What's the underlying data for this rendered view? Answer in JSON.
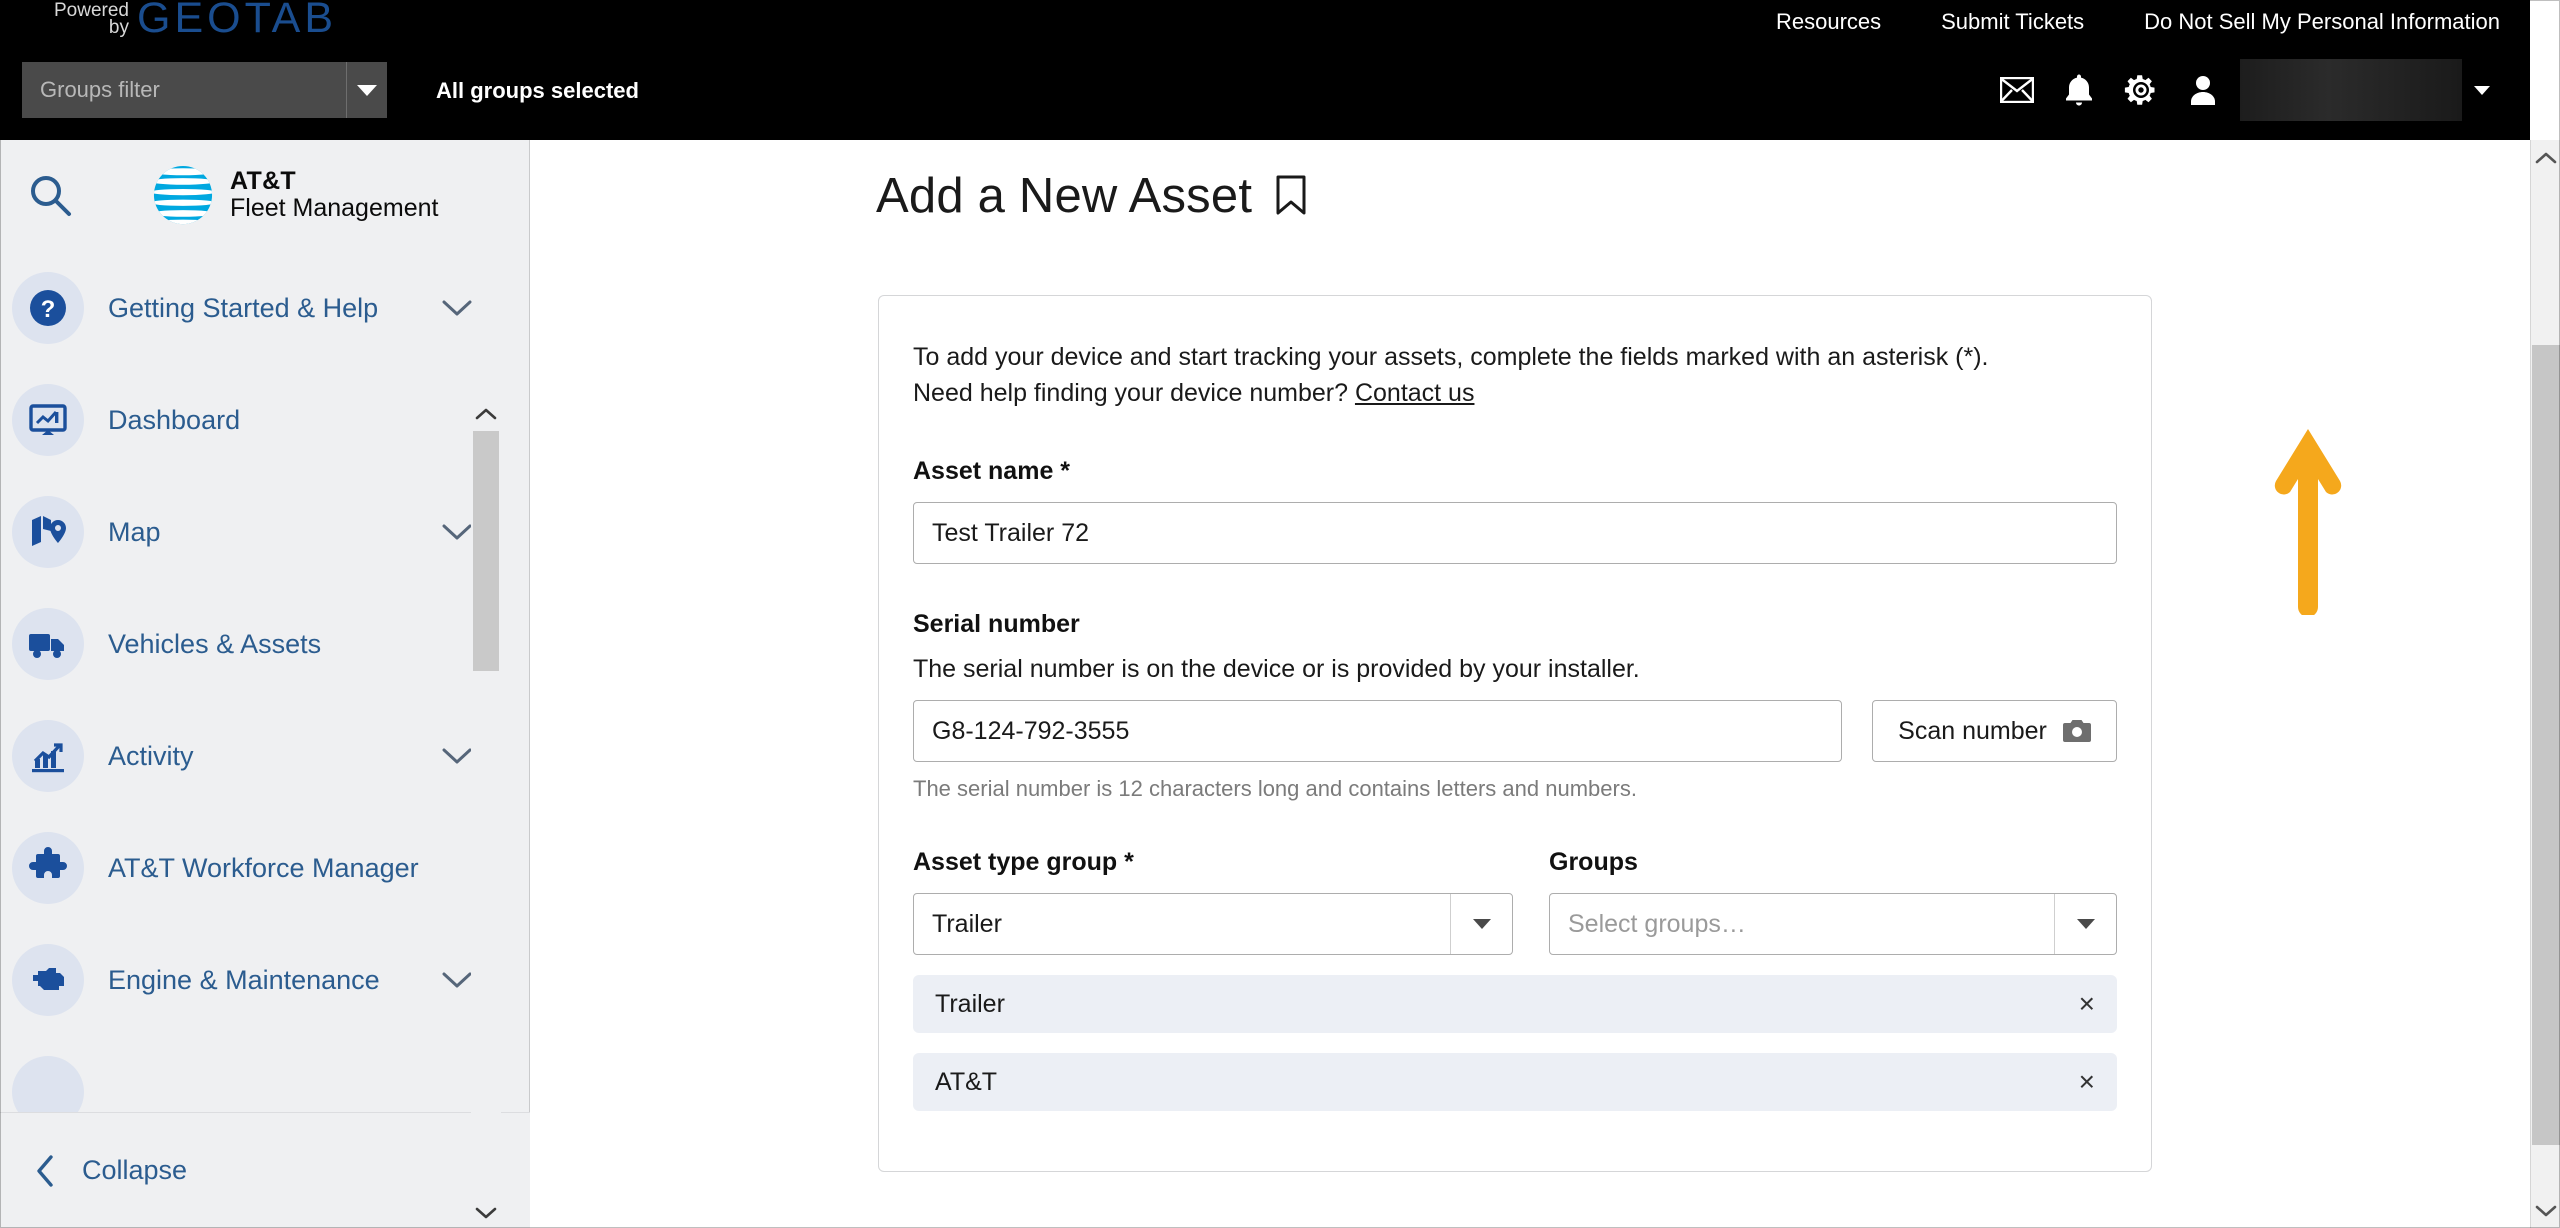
{
  "topbar": {
    "powered_line1": "Powered",
    "powered_line2": "by",
    "brand_logo": "GEOTAB",
    "nav_links": [
      {
        "label": "Resources"
      },
      {
        "label": "Submit Tickets"
      },
      {
        "label": "Do Not Sell My Personal Information"
      }
    ],
    "groups_filter_placeholder": "Groups filter",
    "groups_filter_value": "",
    "all_groups_label": "All groups selected",
    "icons": [
      {
        "name": "mail-icon"
      },
      {
        "name": "bell-icon"
      },
      {
        "name": "gear-icon"
      },
      {
        "name": "user-icon"
      }
    ],
    "user_name": ""
  },
  "sidebar": {
    "search_icon": "search-icon",
    "brand_line1": "AT&T",
    "brand_line2": "Fleet Management",
    "items": [
      {
        "label": "Getting Started & Help",
        "icon": "help-circle-icon",
        "has_chevron": true
      },
      {
        "label": "Dashboard",
        "icon": "dashboard-monitor-icon",
        "has_chevron": false
      },
      {
        "label": "Map",
        "icon": "map-pin-icon",
        "has_chevron": true
      },
      {
        "label": "Vehicles & Assets",
        "icon": "truck-icon",
        "has_chevron": false
      },
      {
        "label": "Activity",
        "icon": "bar-chart-icon",
        "has_chevron": true
      },
      {
        "label": "AT&T Workforce Manager",
        "icon": "puzzle-piece-icon",
        "has_chevron": false
      },
      {
        "label": "Engine & Maintenance",
        "icon": "engine-icon",
        "has_chevron": true
      }
    ],
    "collapse_label": "Collapse"
  },
  "main": {
    "page_title": "Add a New Asset",
    "bookmark_icon": "bookmark-icon",
    "intro_line1": "To add your device and start tracking your assets, complete the fields marked with an asterisk (*).",
    "intro_line2_prefix": "Need help finding your device number? ",
    "intro_link": "Contact us",
    "asset_name": {
      "label": "Asset name *",
      "value": "Test Trailer 72",
      "placeholder": ""
    },
    "serial_number": {
      "label": "Serial number",
      "description": "The serial number is on the device or is provided by your installer.",
      "value": "G8-124-792-3555",
      "placeholder": "",
      "hint": "The serial number is 12 characters long and contains letters and numbers.",
      "scan_button_label": "Scan number",
      "scan_button_icon": "camera-icon"
    },
    "asset_type_group": {
      "label": "Asset type group *",
      "value": "Trailer"
    },
    "groups": {
      "label": "Groups",
      "placeholder": "Select groups…",
      "value": ""
    },
    "selected_chips": [
      {
        "label": "Trailer",
        "remove": "×"
      },
      {
        "label": "AT&T",
        "remove": "×"
      }
    ]
  },
  "annotation": {
    "arrow_color": "#F5A81C",
    "direction": "up"
  },
  "colors": {
    "topbar_bg": "#000000",
    "sidebar_bg": "#EFF0F2",
    "link_blue": "#2B5C8F",
    "geotab_blue": "#1A4D8F",
    "att_blue": "#00A8E0",
    "chip_bg": "#ECEFF5"
  }
}
